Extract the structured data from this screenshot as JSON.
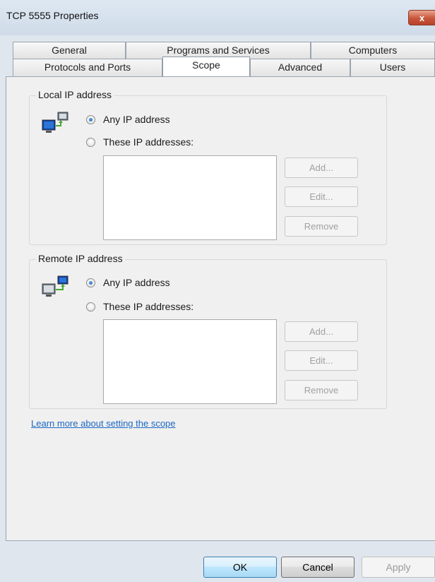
{
  "window": {
    "title": "TCP 5555 Properties",
    "close_label": "x"
  },
  "tabs": {
    "row1": [
      "General",
      "Programs and Services",
      "Computers"
    ],
    "row2": [
      "Protocols and Ports",
      "Scope",
      "Advanced",
      "Users"
    ],
    "active": "Scope"
  },
  "local": {
    "group_label": "Local IP address",
    "icon": "network-computers-icon",
    "radio_any": "Any IP address",
    "radio_these": "These IP addresses:",
    "any_checked": true,
    "add": "Add...",
    "edit": "Edit...",
    "remove": "Remove"
  },
  "remote": {
    "group_label": "Remote IP address",
    "icon": "network-computers-icon",
    "radio_any": "Any IP address",
    "radio_these": "These IP addresses:",
    "any_checked": true,
    "add": "Add...",
    "edit": "Edit...",
    "remove": "Remove"
  },
  "learn_more_link": "Learn more about setting the scope",
  "footer": {
    "ok": "OK",
    "cancel": "Cancel",
    "apply": "Apply"
  },
  "colors": {
    "link": "#1b67c2",
    "close_button": "#c8553b",
    "selected_radio": "#1d5fb8"
  }
}
